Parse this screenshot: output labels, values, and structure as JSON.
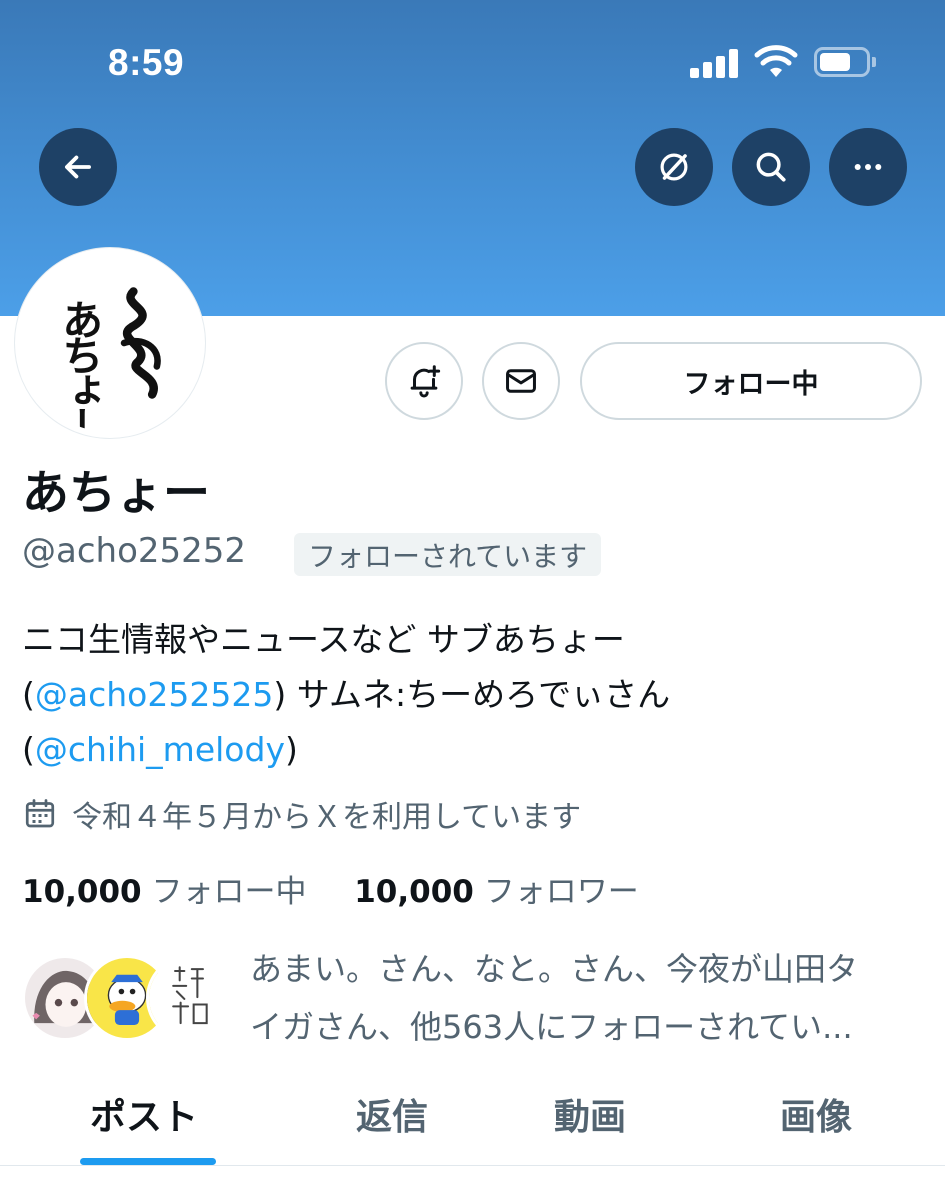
{
  "status_bar": {
    "time": "8:59"
  },
  "header": {
    "back_icon": "arrow-left-icon",
    "actions": [
      "grok-icon",
      "search-icon",
      "more-icon"
    ]
  },
  "profile": {
    "avatar_text": "あちょー",
    "display_name": "あちょー",
    "handle": "@acho25252",
    "follows_you_badge": "フォローされています",
    "follow_button_label": "フォロー中",
    "bio": {
      "line1": "ニコ生情報やニュースなど サブあちょー",
      "line2_prefix": "(",
      "line2_link": "@acho252525",
      "line2_suffix": ") サムネ:ちーめろでぃさん",
      "line3_prefix": "(",
      "line3_link": "@chihi_melody",
      "line3_suffix": ")"
    },
    "joined": "令和４年５月からＸを利用しています",
    "following_count": "10,000",
    "following_label": "フォロー中",
    "followers_count": "10,000",
    "followers_label": "フォロワー",
    "known_followers": {
      "line1": "あまい。さん、なと。さん、今夜が山田タ",
      "line2": "イガさん、他563人にフォローされてい..."
    }
  },
  "tabs": [
    {
      "label": "ポスト",
      "active": true
    },
    {
      "label": "返信",
      "active": false
    },
    {
      "label": "動画",
      "active": false
    },
    {
      "label": "画像",
      "active": false
    }
  ],
  "colors": {
    "accent": "#1d9bf0",
    "banner_top": "#3a79b8",
    "banner_bottom": "#4c9fe8",
    "secondary_text": "#536471"
  }
}
